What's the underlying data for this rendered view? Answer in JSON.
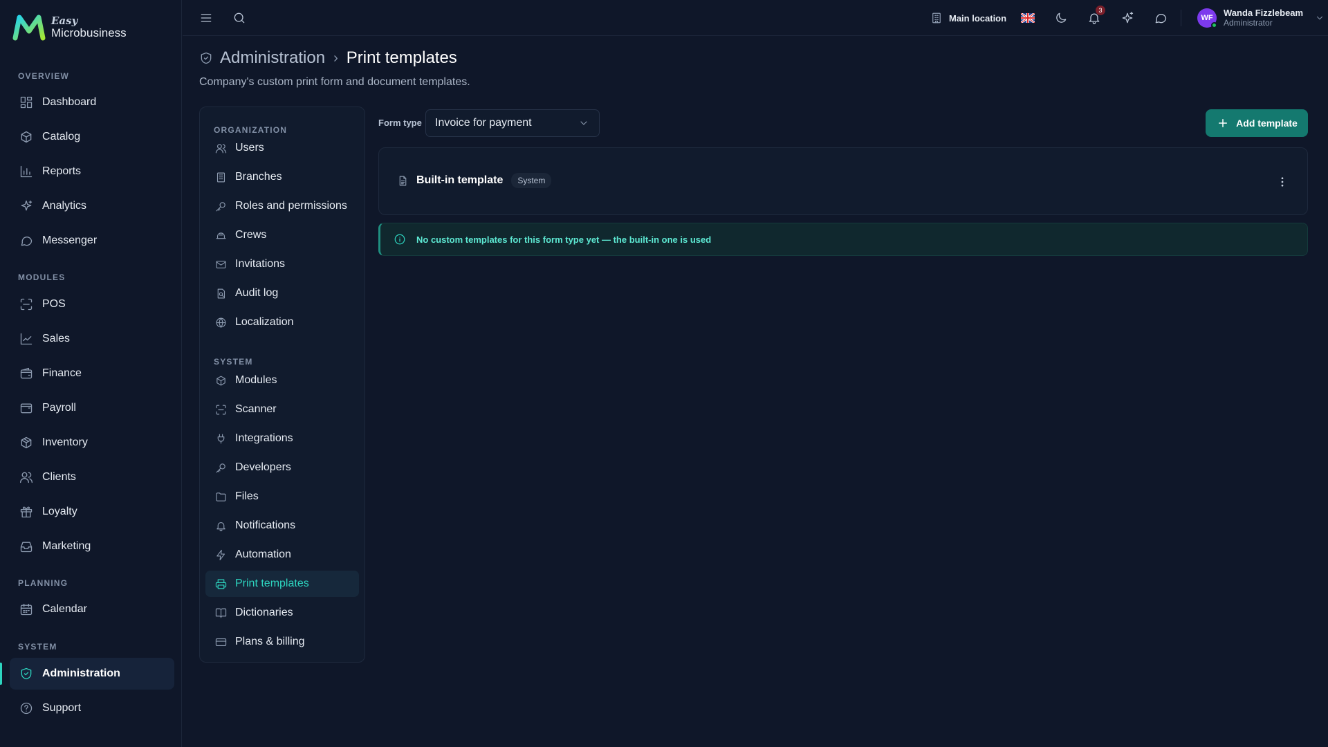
{
  "app": {
    "logo_small": "Easy",
    "logo_name": "Microbusiness"
  },
  "sidebar": {
    "sections": [
      {
        "label": "OVERVIEW",
        "items": [
          {
            "label": "Dashboard",
            "icon": "dashboard-icon"
          },
          {
            "label": "Catalog",
            "icon": "catalog-icon"
          },
          {
            "label": "Reports",
            "icon": "reports-icon"
          },
          {
            "label": "Analytics",
            "icon": "analytics-icon"
          },
          {
            "label": "Messenger",
            "icon": "messenger-icon"
          }
        ]
      },
      {
        "label": "MODULES",
        "items": [
          {
            "label": "POS",
            "icon": "scan-icon"
          },
          {
            "label": "Sales",
            "icon": "sales-chart-icon"
          },
          {
            "label": "Finance",
            "icon": "wallet-icon"
          },
          {
            "label": "Payroll",
            "icon": "payroll-icon"
          },
          {
            "label": "Inventory",
            "icon": "box-icon"
          },
          {
            "label": "Clients",
            "icon": "users-icon"
          },
          {
            "label": "Loyalty",
            "icon": "gift-icon"
          },
          {
            "label": "Marketing",
            "icon": "inbox-icon"
          }
        ]
      },
      {
        "label": "PLANNING",
        "items": [
          {
            "label": "Calendar",
            "icon": "calendar-icon"
          }
        ]
      },
      {
        "label": "SYSTEM",
        "items": [
          {
            "label": "Administration",
            "icon": "shield-icon",
            "active": true
          },
          {
            "label": "Support",
            "icon": "help-icon"
          }
        ]
      }
    ]
  },
  "topbar": {
    "location": "Main location",
    "language": "English (UK flag)",
    "notification_count": "3",
    "user_initials": "WF",
    "user_name": "Wanda Fizzlebeam",
    "user_role": "Administrator"
  },
  "page": {
    "breadcrumb_parent": "Administration",
    "breadcrumb_separator": "›",
    "title": "Print templates",
    "subtitle": "Company's custom print form and document templates."
  },
  "admin_nav": {
    "sections": [
      {
        "label": "ORGANIZATION",
        "items": [
          {
            "label": "Users",
            "icon": "users-icon"
          },
          {
            "label": "Branches",
            "icon": "building-icon"
          },
          {
            "label": "Roles and permissions",
            "icon": "key-icon"
          },
          {
            "label": "Crews",
            "icon": "hard-hat-icon"
          },
          {
            "label": "Invitations",
            "icon": "mail-icon"
          },
          {
            "label": "Audit log",
            "icon": "audit-icon"
          },
          {
            "label": "Localization",
            "icon": "globe-icon"
          }
        ]
      },
      {
        "label": "SYSTEM",
        "items": [
          {
            "label": "Modules",
            "icon": "box-icon"
          },
          {
            "label": "Scanner",
            "icon": "scan-icon"
          },
          {
            "label": "Integrations",
            "icon": "plug-icon"
          },
          {
            "label": "Developers",
            "icon": "key-icon"
          },
          {
            "label": "Files",
            "icon": "folder-icon"
          },
          {
            "label": "Notifications",
            "icon": "bell-icon"
          },
          {
            "label": "Automation",
            "icon": "zap-icon"
          },
          {
            "label": "Print templates",
            "icon": "printer-icon",
            "active": true
          },
          {
            "label": "Dictionaries",
            "icon": "book-icon"
          },
          {
            "label": "Plans & billing",
            "icon": "credit-card-icon"
          }
        ]
      }
    ]
  },
  "content": {
    "form_type_label": "Form type",
    "form_type_value": "Invoice for payment",
    "add_button": "Add template",
    "template_name": "Built-in template",
    "template_badge": "System",
    "info_message": "No custom templates for this form type yet — the built-in one is used"
  },
  "colors": {
    "background": "#0f1729",
    "accent": "#2dd4bf",
    "primary_button": "#14796f",
    "info_text": "#5eead4"
  }
}
